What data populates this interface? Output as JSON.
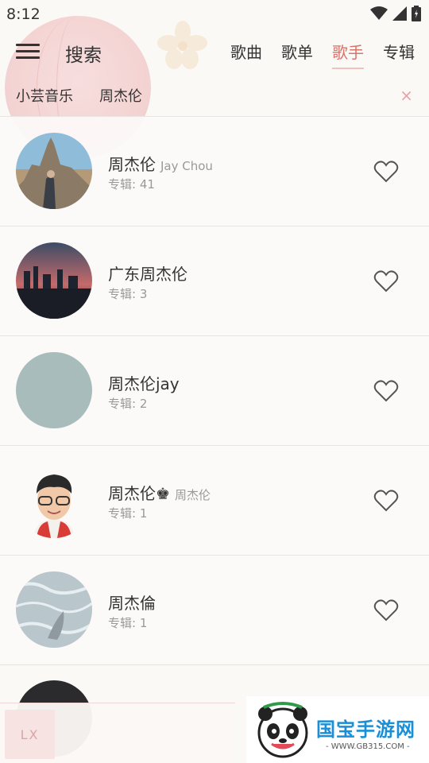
{
  "status_bar": {
    "time": "8:12"
  },
  "header": {
    "title": "搜索",
    "tabs": [
      {
        "label": "歌曲",
        "active": false
      },
      {
        "label": "歌单",
        "active": false
      },
      {
        "label": "歌手",
        "active": true
      },
      {
        "label": "专辑",
        "active": false
      }
    ]
  },
  "search": {
    "source": "小芸音乐",
    "query": "周杰伦",
    "clear_icon": "close-icon"
  },
  "results": [
    {
      "name": "周杰伦",
      "alias": "Jay Chou",
      "albums": "专辑: 41"
    },
    {
      "name": "广东周杰伦",
      "alias": "",
      "albums": "专辑: 3"
    },
    {
      "name": "周杰伦jay",
      "alias": "",
      "albums": "专辑: 2"
    },
    {
      "name": "周杰伦♚",
      "alias": "周杰伦",
      "albums": "专辑: 1"
    },
    {
      "name": "周杰倫",
      "alias": "",
      "albums": "专辑: 1"
    }
  ],
  "player": {
    "cover_text": "LX"
  },
  "watermark": {
    "text": "国宝手游网",
    "url": "- WWW.GB315.COM -"
  },
  "colors": {
    "accent": "#d9736b",
    "background": "#fbf9f6"
  }
}
